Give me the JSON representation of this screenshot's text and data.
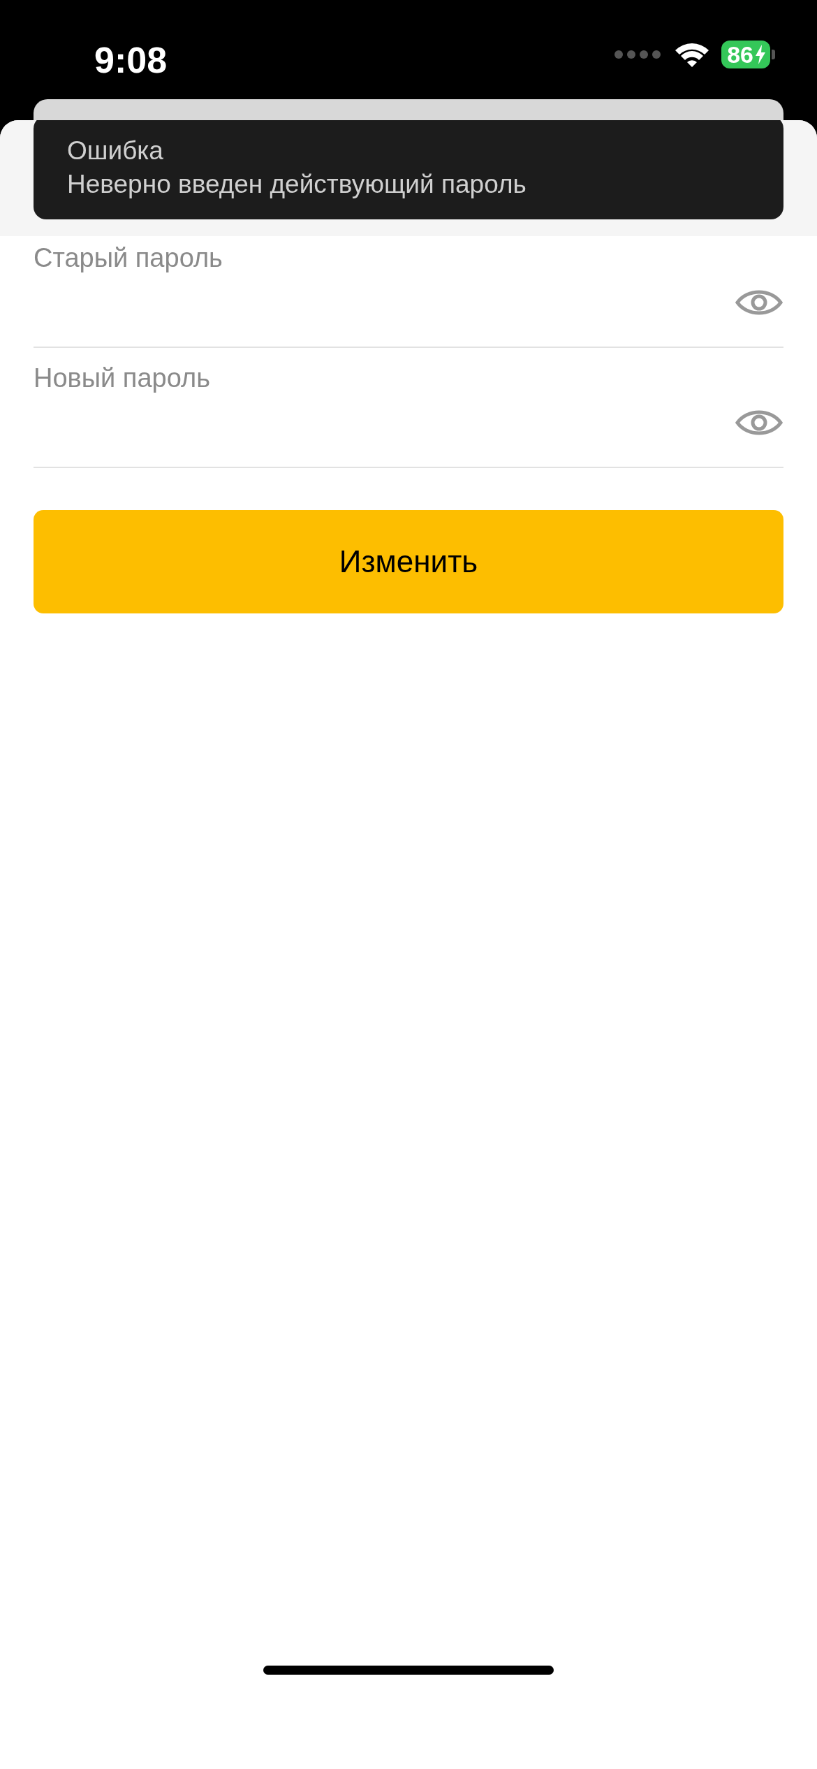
{
  "status_bar": {
    "time": "9:08",
    "battery_percent": "86",
    "charging": true
  },
  "toast": {
    "title": "Ошибка",
    "message": "Неверно введен действующий пароль"
  },
  "fields": [
    {
      "label": "Старый пароль"
    },
    {
      "label": "Новый пароль"
    }
  ],
  "submit_button": {
    "label": "Изменить"
  }
}
